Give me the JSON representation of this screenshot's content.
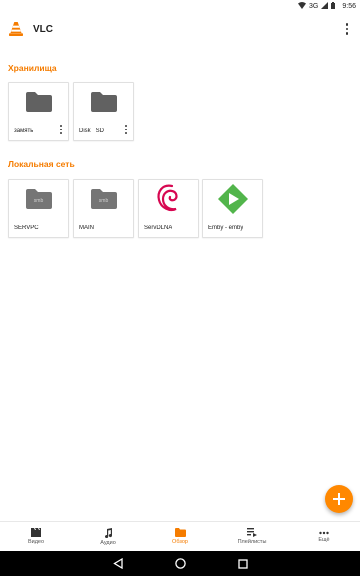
{
  "status_bar": {
    "network": "3G",
    "time": "9:56"
  },
  "app": {
    "title": "VLC"
  },
  "sections": {
    "storage": {
      "title": "Хранилища",
      "items": [
        {
          "label": "замять"
        },
        {
          "label": "Disk   SD"
        }
      ]
    },
    "network": {
      "title": "Локальная сеть",
      "items": [
        {
          "label": "SERVPC",
          "badge": "smb"
        },
        {
          "label": "MAIN",
          "badge": "smb"
        },
        {
          "label": "ServDLNA"
        },
        {
          "label": "Emby - emby"
        }
      ]
    }
  },
  "bottom_nav": [
    {
      "label": "Видео",
      "icon": "video-icon"
    },
    {
      "label": "Аудио",
      "icon": "music-icon"
    },
    {
      "label": "Обзор",
      "icon": "folder-icon",
      "active": true
    },
    {
      "label": "Плейлисты",
      "icon": "playlist-icon"
    },
    {
      "label": "Ещё",
      "icon": "more-icon"
    }
  ],
  "colors": {
    "accent": "#f57c00",
    "fab": "#ff8800",
    "folder": "#616161"
  }
}
